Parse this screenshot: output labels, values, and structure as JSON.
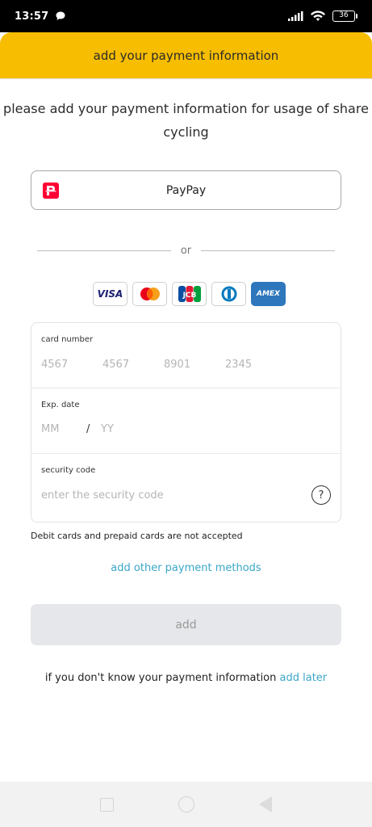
{
  "statusbar": {
    "time": "13:57",
    "battery": "36",
    "icons": [
      "chat-bubble-icon",
      "signal-icon",
      "wifi-icon",
      "battery-icon"
    ]
  },
  "header": {
    "title": "add your payment information",
    "color": "#f7bd00"
  },
  "intro": "please add your payment information for usage of share cycling",
  "paypay": {
    "label": "PayPay",
    "brand_color": "#ff0033"
  },
  "divider": {
    "text": "or"
  },
  "brands": {
    "visa": "VISA",
    "mastercard": "mastercard-logo",
    "jcb": "JCB",
    "diners": "diners-club-logo",
    "amex": "AMEX"
  },
  "form": {
    "card_number": {
      "label": "card number",
      "placeholders": [
        "4567",
        "4567",
        "8901",
        "2345"
      ]
    },
    "exp_date": {
      "label": "Exp. date",
      "mm_placeholder": "MM",
      "slash": "/",
      "yy_placeholder": "YY"
    },
    "security_code": {
      "label": "security code",
      "placeholder": "enter the security code",
      "help": "?"
    }
  },
  "note": "Debit cards and prepaid cards are not accepted",
  "add_other": "add other payment methods",
  "add_button": "add",
  "later": {
    "text": "if you don't know your payment information",
    "link": "add later"
  },
  "colors": {
    "accent": "#f7bd00",
    "link": "#3aa6c8",
    "button_disabled": "#e6e7ea"
  }
}
